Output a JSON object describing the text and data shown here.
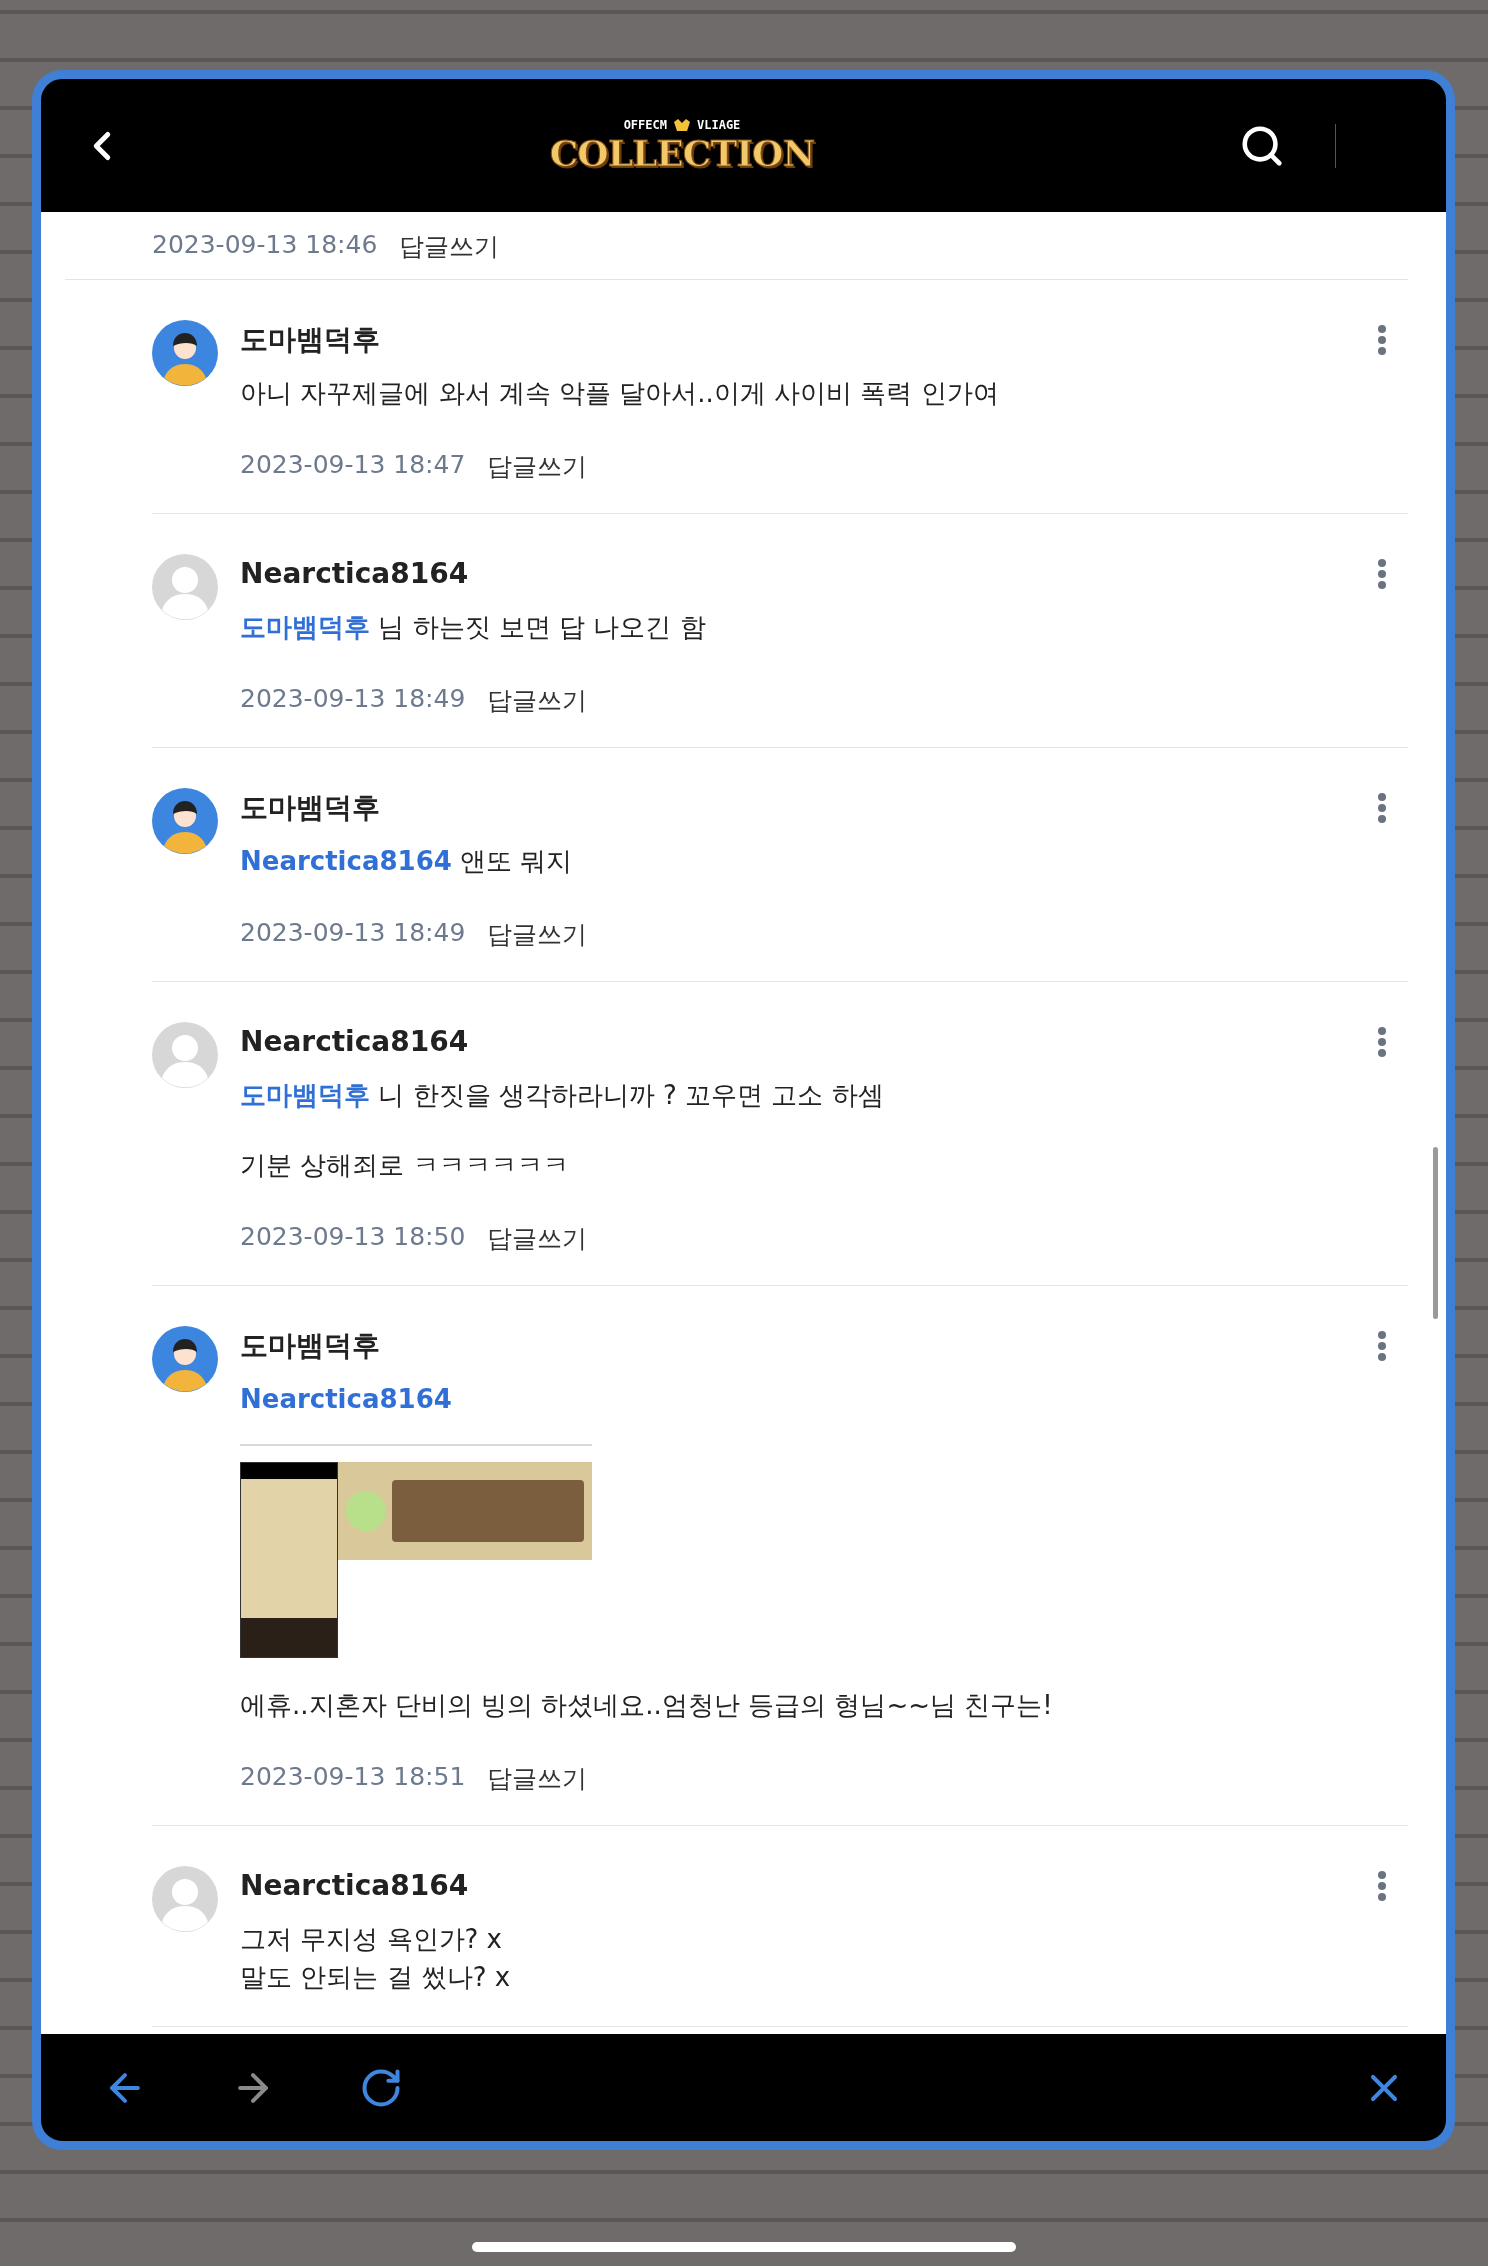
{
  "header": {
    "logo": {
      "top_left": "OFFECM",
      "top_right": "VLIAGE",
      "main": "COLLECTION"
    }
  },
  "previous_meta": {
    "time": "2023-09-13 18:46",
    "reply": "답글쓰기"
  },
  "comments": [
    {
      "author": "도마뱀덕후",
      "kind": "person",
      "paragraphs": [
        {
          "kind": "text",
          "text": "아니 자꾸제글에 와서 계속 악플 달아서..이게 사이비 폭력 인가여"
        }
      ],
      "time": "2023-09-13 18:47",
      "reply": "답글쓰기"
    },
    {
      "author": "Nearctica8164",
      "kind": "default",
      "paragraphs": [
        {
          "kind": "text",
          "mention": "도마뱀덕후",
          "text": "님 하는짓 보면 답 나오긴 함"
        }
      ],
      "time": "2023-09-13 18:49",
      "reply": "답글쓰기"
    },
    {
      "author": "도마뱀덕후",
      "kind": "person",
      "paragraphs": [
        {
          "kind": "text",
          "mention": "Nearctica8164",
          "text": "앤또 뭐지"
        }
      ],
      "time": "2023-09-13 18:49",
      "reply": "답글쓰기"
    },
    {
      "author": "Nearctica8164",
      "kind": "default",
      "paragraphs": [
        {
          "kind": "text",
          "mention": "도마뱀덕후",
          "text": "니 한짓을 생각하라니까 ? 꼬우면 고소 하셈"
        },
        {
          "kind": "text",
          "text": "기분 상해죄로 ㅋㅋㅋㅋㅋㅋ"
        }
      ],
      "time": "2023-09-13 18:50",
      "reply": "답글쓰기"
    },
    {
      "author": "도마뱀덕후",
      "kind": "person",
      "paragraphs": [
        {
          "kind": "text",
          "mention": "Nearctica8164"
        },
        {
          "kind": "image"
        },
        {
          "kind": "text",
          "text": "에휴..지혼자 단비의 빙의 하셨네요..엄청난 등급의 형님~~님 친구는!"
        }
      ],
      "time": "2023-09-13 18:51",
      "reply": "답글쓰기"
    },
    {
      "author": "Nearctica8164",
      "kind": "default",
      "paragraphs": [
        {
          "kind": "lines",
          "lines": [
            "그저 무지성 욕인가? x",
            "말도 안되는 걸 썼나? x"
          ]
        }
      ]
    }
  ],
  "toolbar": [
    {
      "kind": "back",
      "disabled": false
    },
    {
      "kind": "forward",
      "disabled": true
    },
    {
      "kind": "reload",
      "disabled": false
    },
    {
      "kind": "close",
      "disabled": false
    }
  ]
}
